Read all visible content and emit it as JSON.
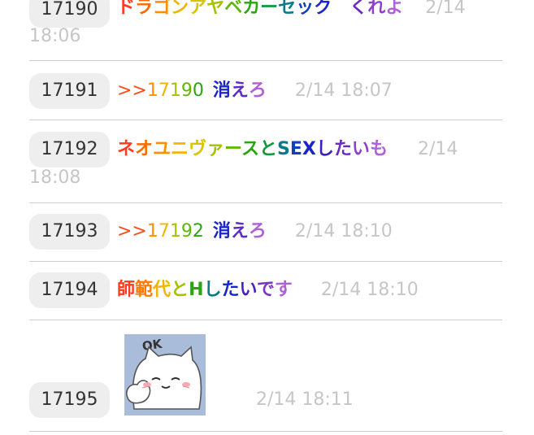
{
  "posts": [
    {
      "number": "17190",
      "timestamp_part1": "2/14",
      "timestamp_part2": "18:06",
      "message_chars": [
        "ド",
        "ラ",
        "ゴ",
        "ン",
        "ア",
        "ヤ",
        "ベ",
        "カ",
        "ー",
        "セ",
        "ッ",
        "ク",
        "　",
        "く",
        "れ",
        "よ"
      ]
    },
    {
      "number": "17191",
      "reply_arrows": ">>",
      "reply_target": "17190",
      "message_chars": [
        "消",
        "え",
        "ろ"
      ],
      "timestamp": "2/14 18:07"
    },
    {
      "number": "17192",
      "timestamp_part1": "2/14",
      "timestamp_part2": "18:08",
      "message_chars": [
        "ネ",
        "オ",
        "ユ",
        "ニ",
        "ヴ",
        "ァ",
        "ー",
        "ス",
        "と",
        "S",
        "E",
        "X",
        "し",
        "た",
        "い",
        "も"
      ]
    },
    {
      "number": "17193",
      "reply_arrows": ">>",
      "reply_target": "17192",
      "message_chars": [
        "消",
        "え",
        "ろ"
      ],
      "timestamp": "2/14 18:10"
    },
    {
      "number": "17194",
      "message_chars": [
        "師",
        "範",
        "代",
        "と",
        "H",
        "し",
        "た",
        "い",
        "で",
        "す"
      ],
      "timestamp": "2/14 18:10"
    },
    {
      "number": "17195",
      "sticker_text": "OK",
      "timestamp": "2/14 18:11"
    }
  ],
  "colors": {
    "rainbow16": [
      "#ff3b1f",
      "#ff6a00",
      "#ff8f00",
      "#f2b400",
      "#d9c400",
      "#a6c200",
      "#5fb800",
      "#2aa70f",
      "#0f9a3a",
      "#0b7a8a",
      "#1140b8",
      "#1a26c8",
      "#3b1fc4",
      "#6a2bc3",
      "#8f3fcf",
      "#b061d6"
    ],
    "rainbow10": [
      "#ff3b1f",
      "#ff7a00",
      "#f2b400",
      "#a6c200",
      "#2aa70f",
      "#0b7a8a",
      "#1a26c8",
      "#4a22c0",
      "#7a34c9",
      "#b061d6"
    ],
    "reply_arrow": "#ff4a1a",
    "reply_target": [
      "#ff8f00",
      "#f2b400",
      "#a6c200",
      "#5fb800",
      "#2aa70f"
    ],
    "kiero": [
      "#1a26c8",
      "#5a2ec5",
      "#b061d6"
    ]
  }
}
